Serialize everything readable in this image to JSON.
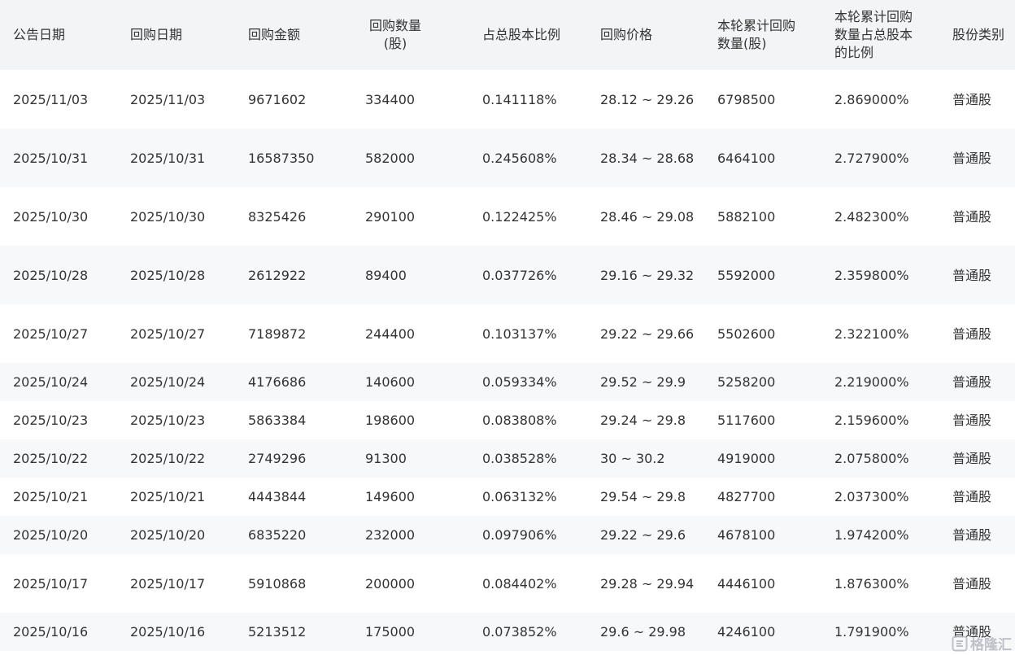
{
  "table": {
    "headers": [
      "公告日期",
      "回购日期",
      "回购金额",
      "回购数量\n(股)",
      "占总股本比例",
      "回购价格",
      "本轮累计回购\n数量(股)",
      "本轮累计回购\n数量占总股本\n的比例",
      "股份类别"
    ],
    "rows": [
      [
        "2025/11/03",
        "2025/11/03",
        "9671602",
        "334400",
        "0.141118%",
        "28.12 ~ 29.26",
        "6798500",
        "2.869000%",
        "普通股"
      ],
      [
        "2025/10/31",
        "2025/10/31",
        "16587350",
        "582000",
        "0.245608%",
        "28.34 ~ 28.68",
        "6464100",
        "2.727900%",
        "普通股"
      ],
      [
        "2025/10/30",
        "2025/10/30",
        "8325426",
        "290100",
        "0.122425%",
        "28.46 ~ 29.08",
        "5882100",
        "2.482300%",
        "普通股"
      ],
      [
        "2025/10/28",
        "2025/10/28",
        "2612922",
        "89400",
        "0.037726%",
        "29.16 ~ 29.32",
        "5592000",
        "2.359800%",
        "普通股"
      ],
      [
        "2025/10/27",
        "2025/10/27",
        "7189872",
        "244400",
        "0.103137%",
        "29.22 ~ 29.66",
        "5502600",
        "2.322100%",
        "普通股"
      ],
      [
        "2025/10/24",
        "2025/10/24",
        "4176686",
        "140600",
        "0.059334%",
        "29.52 ~ 29.9",
        "5258200",
        "2.219000%",
        "普通股"
      ],
      [
        "2025/10/23",
        "2025/10/23",
        "5863384",
        "198600",
        "0.083808%",
        "29.24 ~ 29.8",
        "5117600",
        "2.159600%",
        "普通股"
      ],
      [
        "2025/10/22",
        "2025/10/22",
        "2749296",
        "91300",
        "0.038528%",
        "30 ~ 30.2",
        "4919000",
        "2.075800%",
        "普通股"
      ],
      [
        "2025/10/21",
        "2025/10/21",
        "4443844",
        "149600",
        "0.063132%",
        "29.54 ~ 29.8",
        "4827700",
        "2.037300%",
        "普通股"
      ],
      [
        "2025/10/20",
        "2025/10/20",
        "6835220",
        "232000",
        "0.097906%",
        "29.22 ~ 29.6",
        "4678100",
        "1.974200%",
        "普通股"
      ],
      [
        "2025/10/17",
        "2025/10/17",
        "5910868",
        "200000",
        "0.084402%",
        "29.28 ~ 29.94",
        "4446100",
        "1.876300%",
        "普通股"
      ],
      [
        "2025/10/16",
        "2025/10/16",
        "5213512",
        "175000",
        "0.073852%",
        "29.6 ~ 29.98",
        "4246100",
        "1.791900%",
        "普通股"
      ]
    ]
  },
  "watermark": {
    "text": "格隆汇",
    "icon": "gelonghui-logo-icon"
  },
  "colors": {
    "header_bg": "#f3f4f6",
    "stripe_bg": "#f7f8fa",
    "text": "#333333"
  }
}
